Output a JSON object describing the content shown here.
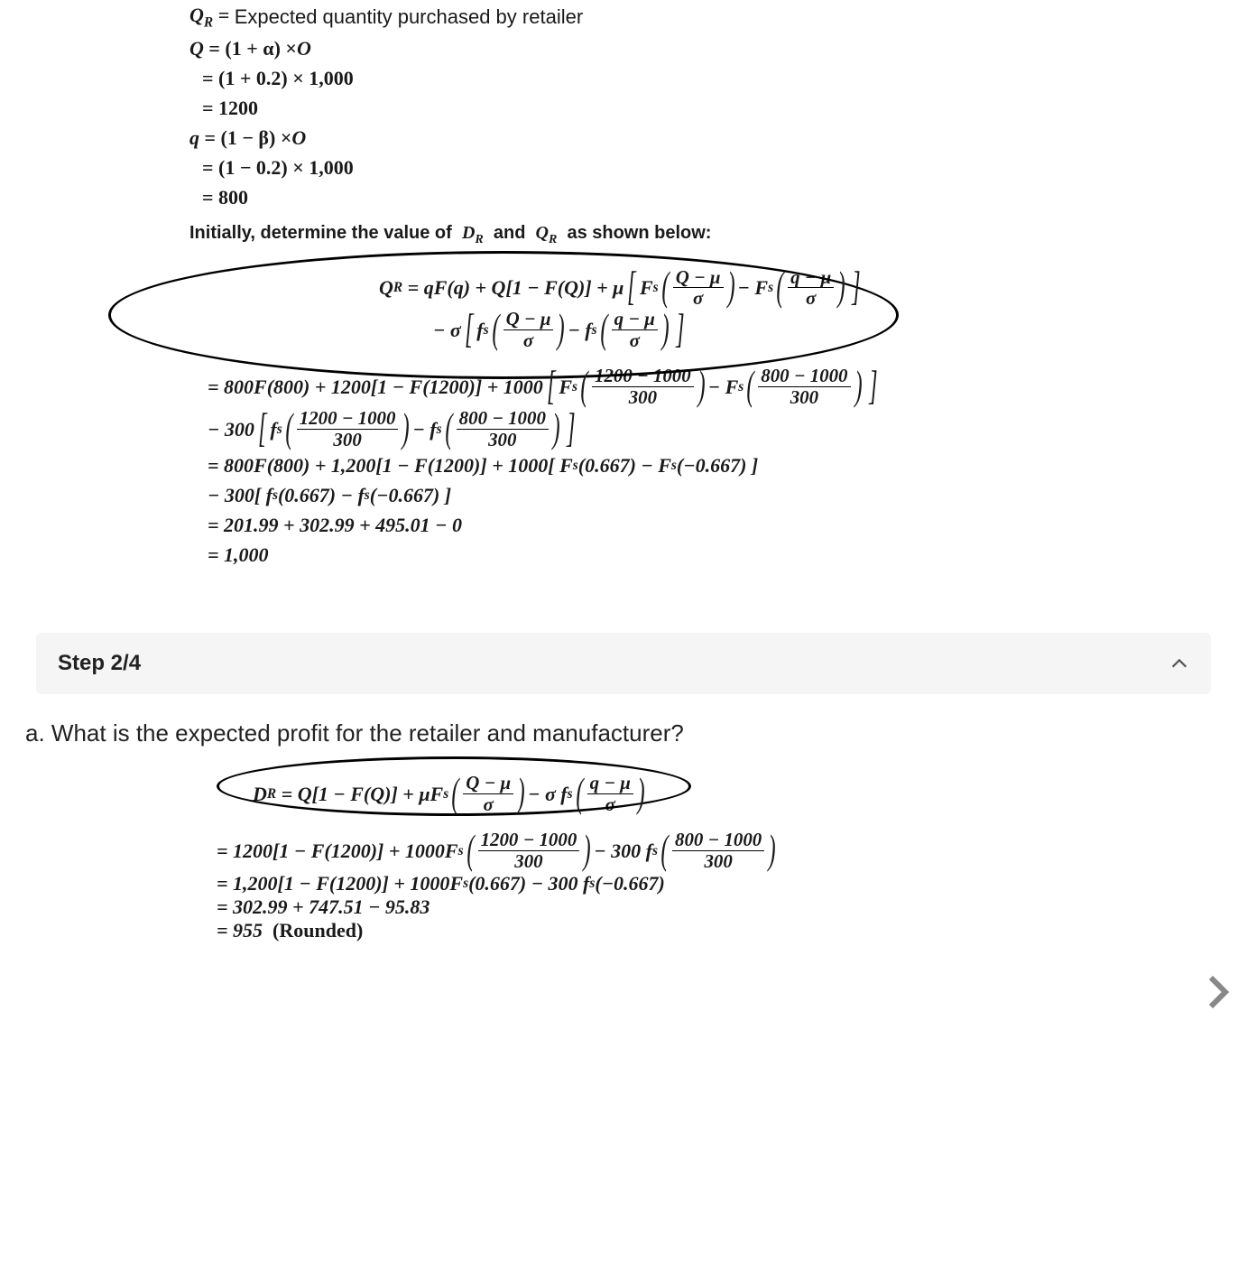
{
  "step1": {
    "def": "Expected quantity purchased by retailer",
    "Q_line1": "Q = (1 + α) × O",
    "Q_line2": "= (1 + 0.2) × 1,000",
    "Q_line3": "= 1200",
    "q_line1": "q = (1 − β) × O",
    "q_line2": "= (1 − 0.2) × 1,000",
    "q_line3": "= 800",
    "instr": "Initially, determine the value of  D_R  and  Q_R  as shown below:",
    "formula_line1": "Q_R = qF(q) + Q[1 − F(Q)] + μ [ F_s( (Q − μ)/σ ) − F_s( (q − μ)/σ ) ]",
    "formula_line2": "− σ [ f_s( (Q − μ)/σ ) − f_s( (q − μ)/σ ) ]",
    "sub1": "= 800F(800) + 1200[1 − F(1200)] + 1000 [ F_s( (1200 − 1000)/300 ) − F_s( (800 − 1000)/300 ) ]",
    "sub2": "− 300 [ f_s( (1200 − 1000)/300 ) − f_s( (800 − 1000)/300 ) ]",
    "sub3": "= 800F(800) + 1,200[1 − F(1200)] + 1000[ F_s(0.667) − F_s(−0.667) ]",
    "sub4": "− 300[ f_s(0.667) − f_s(−0.667) ]",
    "sub5": "= 201.99 + 302.99 + 495.01 − 0",
    "sub6": "= 1,000"
  },
  "step_header": "Step 2/4",
  "question": "a. What is the expected profit for the retailer and manufacturer?",
  "step2": {
    "formula_line1": "D_R = Q[1 − F(Q)] + μF_s( (Q − μ)/σ ) − σ f_s( (q − μ)/σ )",
    "sub1": "= 1200[1 − F(1200)] + 1000F_s( (1200 − 1000)/300 ) − 300 f_s( (800 − 1000)/300 )",
    "sub2": "= 1,200[1 − F(1200)] + 1000F_s(0.667) − 300 f_s(−0.667)",
    "sub3": "= 302.99 + 747.51 − 95.83",
    "sub4": "= 955  (Rounded)"
  }
}
